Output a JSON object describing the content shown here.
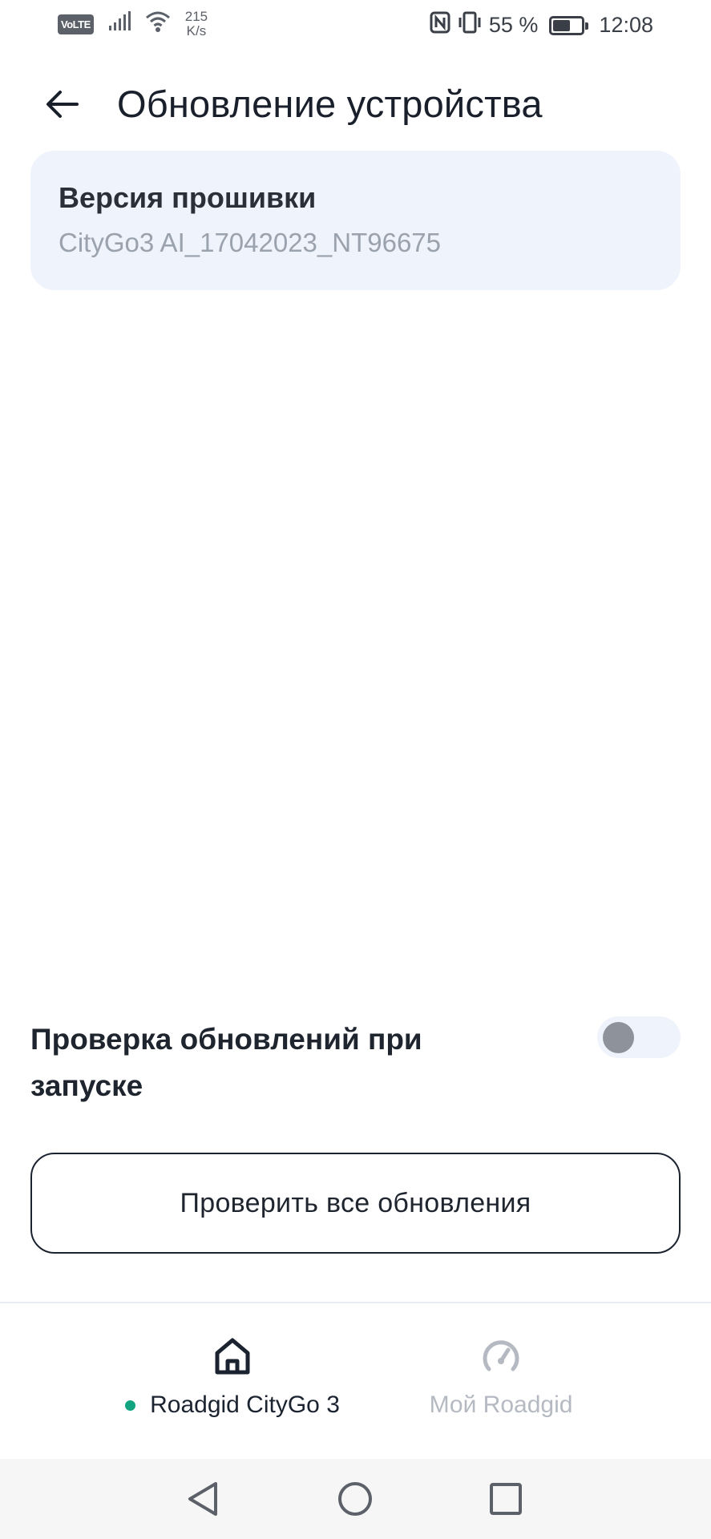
{
  "status_bar": {
    "volte": "VoLTE",
    "speed_value": "215",
    "speed_unit": "K/s",
    "battery_percent": "55 %",
    "battery_level": 0.55,
    "time": "12:08"
  },
  "header": {
    "title": "Обновление устройства"
  },
  "firmware": {
    "label": "Версия прошивки",
    "value": "CityGo3 AI_17042023_NT96675"
  },
  "auto_check": {
    "label": "Проверка обновлений при запуске",
    "enabled": false
  },
  "check_button": {
    "label": "Проверить все обновления"
  },
  "bottom_nav": {
    "items": [
      {
        "label": "Roadgid CityGo 3",
        "icon": "home-icon",
        "active": true
      },
      {
        "label": "Мой Roadgid",
        "icon": "speedometer-icon",
        "active": false
      }
    ]
  },
  "colors": {
    "accent_dot": "#12a480",
    "card_bg": "#eff3fb",
    "text_primary": "#1c2330",
    "text_muted": "#9aa2ad"
  }
}
